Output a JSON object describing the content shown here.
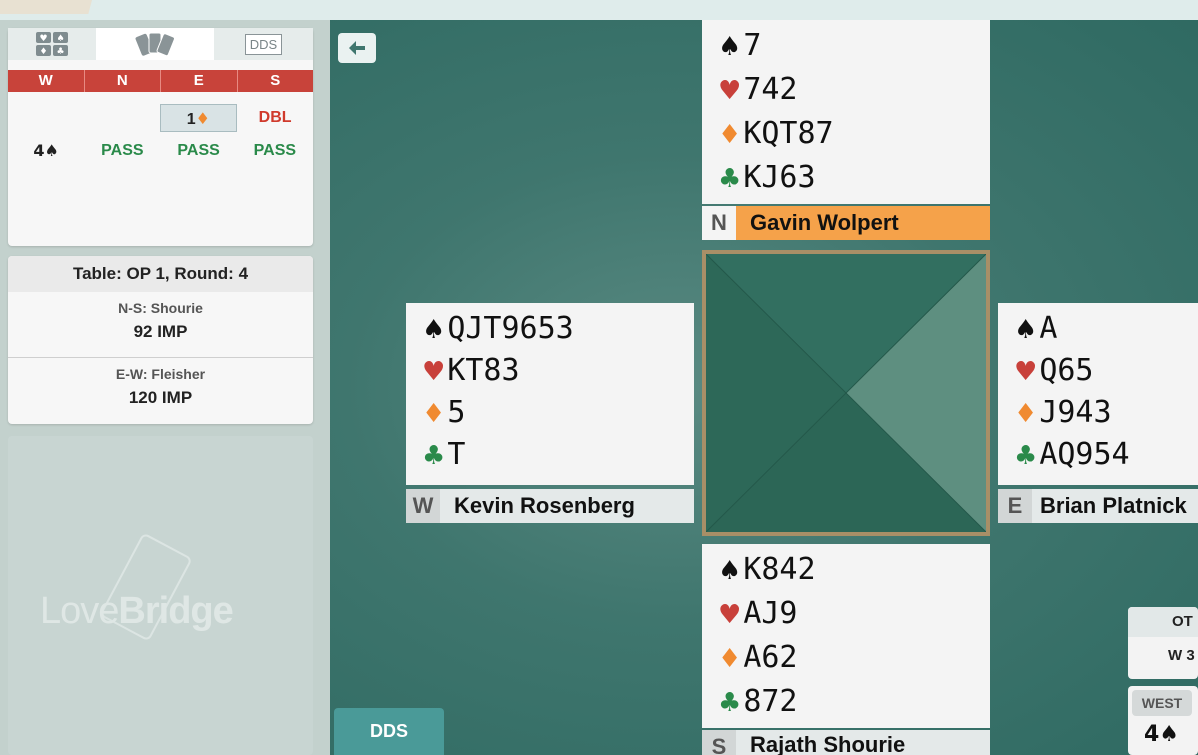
{
  "tabs": {
    "dds_label": "DDS"
  },
  "bidding": {
    "headers": [
      "W",
      "N",
      "E",
      "S"
    ],
    "row1": [
      "",
      "",
      "1♦",
      "DBL"
    ],
    "row2": [
      "4♠",
      "PASS",
      "PASS",
      "PASS"
    ]
  },
  "table_info": {
    "title": "Table: OP 1, Round: 4",
    "ns_label": "N-S: Shourie",
    "ns_score": "92 IMP",
    "ew_label": "E-W: Fleisher",
    "ew_score": "120 IMP"
  },
  "logo": {
    "light": "Love",
    "bold": "Bridge"
  },
  "suits": {
    "spade": "♠",
    "heart": "♥",
    "diamond": "♦",
    "club": "♣"
  },
  "north": {
    "seat": "N",
    "name": "Gavin Wolpert",
    "spades": "7",
    "hearts": "742",
    "diamonds": "KQT87",
    "clubs": "KJ63"
  },
  "west": {
    "seat": "W",
    "name": "Kevin Rosenberg",
    "spades": "QJT9653",
    "hearts": "KT83",
    "diamonds": "5",
    "clubs": "T"
  },
  "east": {
    "seat": "E",
    "name": "Brian Platnick",
    "spades": "A",
    "hearts": "Q65",
    "diamonds": "J943",
    "clubs": "AQ954"
  },
  "south": {
    "seat": "S",
    "name": "Rajath Shourie",
    "spades": "K842",
    "hearts": "AJ9",
    "diamonds": "A62",
    "clubs": "872"
  },
  "dds_button": "DDS",
  "right_cards": {
    "top_header": "OT",
    "top_value": "W 3",
    "bottom_header": "WEST",
    "bottom_value": "4♠"
  },
  "colors": {
    "accent_red": "#c8433a",
    "pass_green": "#2a8a4a",
    "north_orange": "#f5a24a",
    "felt": "#3f766e",
    "dds_teal": "#4a9a98"
  },
  "icons": [
    "back-arrow-icon",
    "dummy-cards-icon",
    "fan-cards-icon",
    "dds-icon"
  ]
}
